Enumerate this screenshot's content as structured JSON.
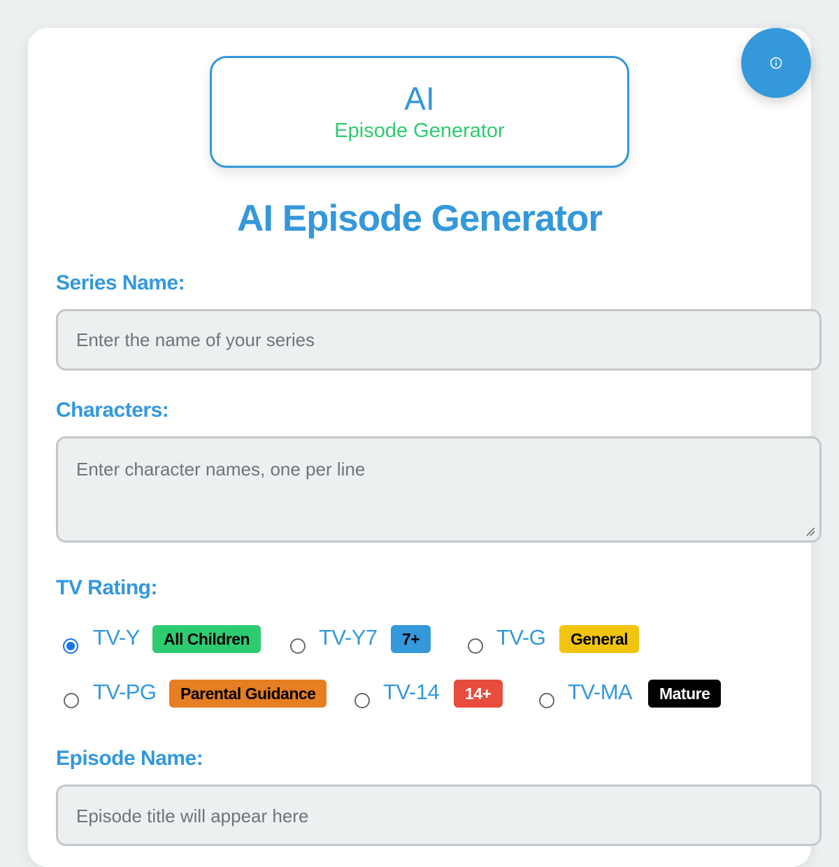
{
  "app": {
    "logo": {
      "main": "AI",
      "sub": "Episode Generator"
    },
    "title": "AI Episode Generator",
    "info_icon": "info-circle-icon"
  },
  "form": {
    "series": {
      "label": "Series Name:",
      "placeholder": "Enter the name of your series"
    },
    "characters": {
      "label": "Characters:",
      "placeholder": "Enter character names, one per line"
    },
    "rating": {
      "label": "TV Rating:",
      "options": [
        {
          "value": "TV-Y",
          "badge": "All Children",
          "badge_color": "#2ecc71",
          "badge_text_color": "#000000",
          "selected": true
        },
        {
          "value": "TV-Y7",
          "badge": "7+",
          "badge_color": "#3498db",
          "badge_text_color": "#000000",
          "selected": false
        },
        {
          "value": "TV-G",
          "badge": "General",
          "badge_color": "#f1c40f",
          "badge_text_color": "#000000",
          "selected": false
        },
        {
          "value": "TV-PG",
          "badge": "Parental Guidance",
          "badge_color": "#e67e22",
          "badge_text_color": "#000000",
          "selected": false
        },
        {
          "value": "TV-14",
          "badge": "14+",
          "badge_color": "#e74c3c",
          "badge_text_color": "#ffffff",
          "selected": false
        },
        {
          "value": "TV-MA",
          "badge": "Mature",
          "badge_color": "#000000",
          "badge_text_color": "#ffffff",
          "selected": false
        }
      ]
    },
    "episode": {
      "label": "Episode Name:",
      "placeholder": "Episode title will appear here"
    }
  },
  "colors": {
    "accent": "#3498db",
    "secondary": "#2ecc71",
    "background": "#ecf0f1"
  }
}
